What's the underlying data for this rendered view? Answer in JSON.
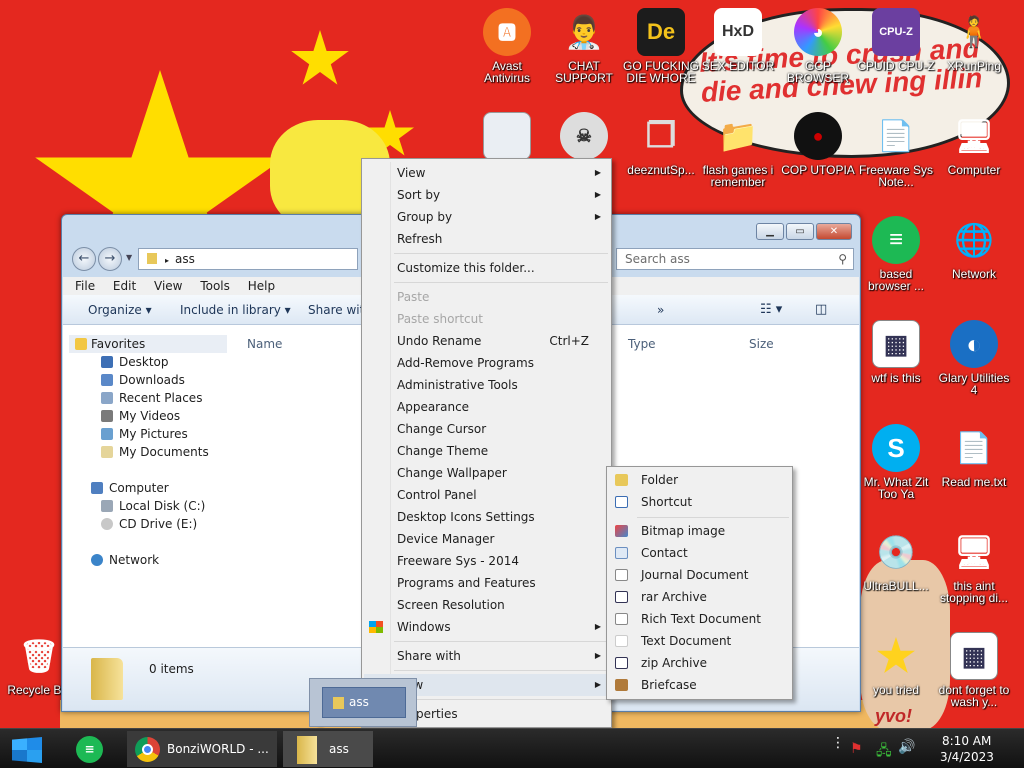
{
  "wallpaper": {
    "bubble_text": "It's time to crush and die and chew ing illin",
    "corner_text": "yvo!"
  },
  "desktop_icons": {
    "avast": {
      "label": "Avast Antivirus",
      "glyph": "🅰"
    },
    "chat": {
      "label": "CHAT SUPPORT",
      "glyph": "👨‍⚕️"
    },
    "die": {
      "label": "GO FUCKING DIE WHORE",
      "glyph": "De"
    },
    "hxd": {
      "label": "SEX EDITOR",
      "glyph": "HxD"
    },
    "gcp": {
      "label": "GCP BROWSER",
      "glyph": "◕"
    },
    "cpuz": {
      "label": "CPUID CPU-Z",
      "glyph": "CPU-Z"
    },
    "xrun": {
      "label": "XRunPing",
      "glyph": "🧍"
    },
    "deeznut": {
      "label": "deeznutSp...",
      "glyph": "❐"
    },
    "flash": {
      "label": "flash games i remember",
      "glyph": "📁"
    },
    "utopia": {
      "label": "COP UTOPIA",
      "glyph": "●"
    },
    "freeware": {
      "label": "Freeware Sys Note...",
      "glyph": "📄"
    },
    "computer": {
      "label": "Computer",
      "glyph": "🖥"
    },
    "based": {
      "label": "based browser ...",
      "glyph": "≡"
    },
    "network": {
      "label": "Network",
      "glyph": "🌐"
    },
    "wtf": {
      "label": "wtf is this",
      "glyph": "▦"
    },
    "glary": {
      "label": "Glary Utilities 4",
      "glyph": "◐"
    },
    "skype": {
      "label": "Mr. What Zit Too Ya",
      "glyph": "S"
    },
    "readme": {
      "label": "Read me.txt",
      "glyph": "📄"
    },
    "ultrabull": {
      "label": "UltraBULL...",
      "glyph": "💿"
    },
    "aint": {
      "label": "this aint stopping di...",
      "glyph": "🖥"
    },
    "youtried": {
      "label": "you tried",
      "glyph": "★"
    },
    "dontforget": {
      "label": "dont forget to wash y...",
      "glyph": "▦"
    },
    "recycle": {
      "label": "Recycle Bin",
      "glyph": "🗑"
    }
  },
  "explorer": {
    "address": "ass",
    "search_placeholder": "Search ass",
    "menu": [
      "File",
      "Edit",
      "View",
      "Tools",
      "Help"
    ],
    "cmd": {
      "organize": "Organize ▾",
      "include": "Include in library ▾",
      "share": "Share with",
      "more": "»"
    },
    "columns": {
      "name": "Name",
      "type": "Type",
      "size": "Size"
    },
    "nav": {
      "favorites": "Favorites",
      "desktop": "Desktop",
      "downloads": "Downloads",
      "recent": "Recent Places",
      "videos": "My Videos",
      "pictures": "My Pictures",
      "documents": "My Documents",
      "computer": "Computer",
      "local_disk": "Local Disk (C:)",
      "cd_drive": "CD Drive (E:)",
      "network": "Network"
    },
    "status": "0 items"
  },
  "context_menu": {
    "view": "View",
    "sort_by": "Sort by",
    "group_by": "Group by",
    "refresh": "Refresh",
    "customize": "Customize this folder...",
    "paste": "Paste",
    "paste_shortcut": "Paste shortcut",
    "undo_rename": "Undo Rename",
    "undo_shortcut": "Ctrl+Z",
    "add_remove": "Add-Remove Programs",
    "admin_tools": "Administrative Tools",
    "appearance": "Appearance",
    "change_cursor": "Change Cursor",
    "change_theme": "Change Theme",
    "change_wallpaper": "Change Wallpaper",
    "control_panel": "Control Panel",
    "desktop_icons": "Desktop Icons Settings",
    "device_manager": "Device Manager",
    "freeware_sys": "Freeware Sys - 2014",
    "programs_features": "Programs and Features",
    "screen_resolution": "Screen Resolution",
    "windows": "Windows",
    "share_with": "Share with",
    "new": "New",
    "properties": "Properties"
  },
  "new_submenu": {
    "folder": "Folder",
    "shortcut": "Shortcut",
    "bitmap": "Bitmap image",
    "contact": "Contact",
    "journal": "Journal Document",
    "rar": "rar Archive",
    "rtf": "Rich Text Document",
    "text": "Text Document",
    "zip": "zip Archive",
    "briefcase": "Briefcase"
  },
  "drag": {
    "label": "ass"
  },
  "taskbar": {
    "bonzi": "BonziWORLD - ...",
    "ass": "ass",
    "time": "8:10 AM",
    "date": "3/4/2023"
  },
  "colors": {
    "accent": "#dfe6ee",
    "taskbar": "#1a1a1a",
    "wallpaper": "#e4281f"
  }
}
